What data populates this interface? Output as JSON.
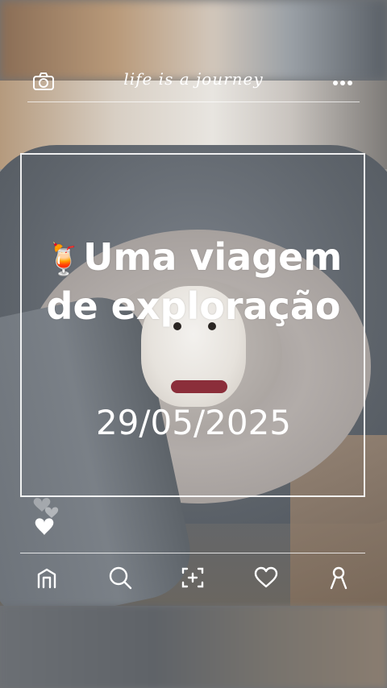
{
  "header": {
    "left_icon": "camera-icon",
    "title": "life is a journey",
    "right_icon": "more-icon"
  },
  "post": {
    "emoji": "🍹",
    "headline": "Uma viagem de exploração",
    "date": "29/05/2025"
  },
  "nav": {
    "items": [
      {
        "icon": "home-icon"
      },
      {
        "icon": "search-icon"
      },
      {
        "icon": "add-icon"
      },
      {
        "icon": "heart-icon"
      },
      {
        "icon": "profile-icon"
      }
    ]
  },
  "colors": {
    "overlay_text": "#ffffff",
    "chair": "#6c7279",
    "bed": "#b2aca9"
  }
}
